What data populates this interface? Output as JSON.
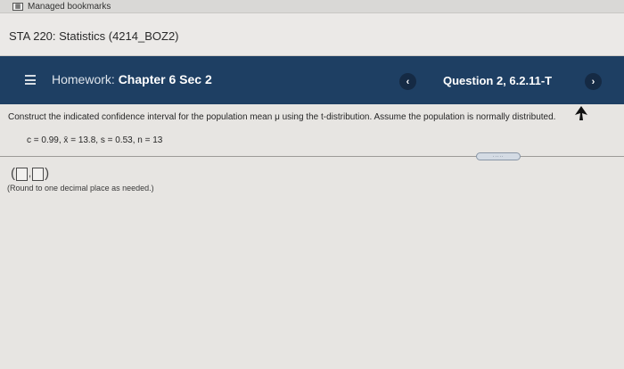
{
  "bookmarks_bar": {
    "label": "Managed bookmarks"
  },
  "course": {
    "title": "STA 220: Statistics (4214_BOZ2)"
  },
  "homework_bar": {
    "prefix": "Homework:",
    "chapter": "Chapter 6 Sec 2",
    "question": "Question 2, 6.2.11-T",
    "prev_symbol": "‹",
    "next_symbol": "›"
  },
  "question": {
    "prompt": "Construct the indicated confidence interval for the population mean μ using the t-distribution. Assume the population is normally distributed.",
    "givens": "c = 0.99,  x̄ = 13.8,  s = 0.53,  n = 13",
    "more_label": "·····",
    "answer_open": "(",
    "answer_sep": ",",
    "answer_close": ")",
    "hint": "(Round to one decimal place as needed.)"
  },
  "colors": {
    "homework_bar": "#1e3f63",
    "nav_button": "#152a44",
    "page_background": "#e7e5e2"
  },
  "icons": {
    "menu": "hamburger-icon",
    "prev": "chevron-left-icon",
    "next": "chevron-right-icon",
    "cursor": "mouse-cursor-icon"
  }
}
